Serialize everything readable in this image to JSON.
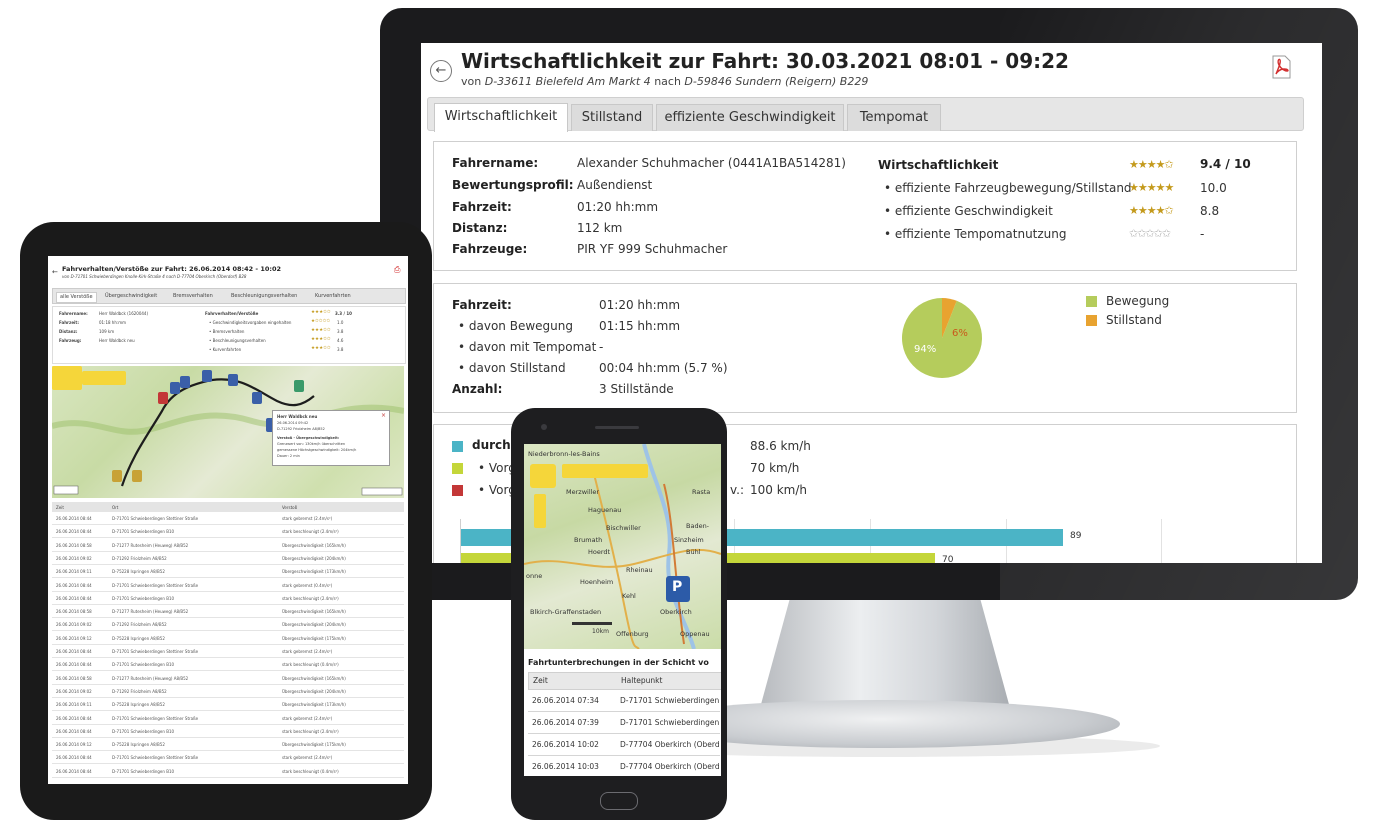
{
  "monitor": {
    "title": "Wirtschaftlichkeit zur Fahrt: 30.03.2021 08:01 - 09:22",
    "subtitle_prefix": "von",
    "subtitle_from": "D-33611 Bielefeld Am Markt 4",
    "subtitle_mid": "nach",
    "subtitle_to": "D-59846 Sundern (Reigern) B229",
    "tabs": [
      "Wirtschaftlichkeit",
      "Stillstand",
      "effiziente Geschwindigkeit",
      "Tempomat"
    ],
    "info": {
      "driver_label": "Fahrername:",
      "driver_value": "Alexander Schuhmacher (0441A1BA514281)",
      "profile_label": "Bewertungsprofil:",
      "profile_value": "Außendienst",
      "time_label": "Fahrzeit:",
      "time_value": "01:20 hh:mm",
      "distance_label": "Distanz:",
      "distance_value": "112 km",
      "vehicles_label": "Fahrzeuge:",
      "vehicles_value": "PIR YF 999 Schuhmacher"
    },
    "rating": {
      "title": "Wirtschaftlichkeit",
      "title_stars": "★★★★✩",
      "title_score": "9.4 / 10",
      "items": [
        {
          "label": "• effiziente Fahrzeugbewegung/Stillstand",
          "stars": "★★★★★",
          "score": "10.0"
        },
        {
          "label": "• effiziente Geschwindigkeit",
          "stars": "★★★★✩",
          "score": "8.8"
        },
        {
          "label": "• effiziente Tempomatnutzung",
          "stars": "✩✩✩✩✩",
          "score": "-"
        }
      ]
    },
    "standstill": {
      "time_label": "Fahrzeit:",
      "time_value": "01:20 hh:mm",
      "movement_label": "• davon Bewegung",
      "movement_value": "01:15 hh:mm",
      "tempomat_label": "• davon mit Tempomat",
      "tempomat_value": "-",
      "still_label": "• davon Stillstand",
      "still_value": "00:04 hh:mm (5.7 %)",
      "count_label": "Anzahl:",
      "count_value": "3 Stillstände",
      "pie_big_label": "94%",
      "pie_small_label": "6%",
      "legend": [
        {
          "label": "Bewegung",
          "color": "#b5cc5c"
        },
        {
          "label": "Stillstand",
          "color": "#e8a330"
        }
      ]
    },
    "speed": {
      "avg_label": "durchs",
      "avg_value": "88.6 km/h",
      "rows": [
        {
          "label": "• Vorga",
          "value": "70 km/h",
          "color": "#b5cc5c"
        },
        {
          "label": "• Vorga",
          "prefix": "v.:",
          "value": "100 km/h",
          "color": "#c33737"
        }
      ],
      "bar_value_label": "89",
      "bar2_value_label": "70",
      "bar_color": "#4bb4c6",
      "bar2_color": "#c4d63a"
    }
  },
  "chart_data": {
    "type": "pie",
    "categories": [
      "Bewegung",
      "Stillstand"
    ],
    "values": [
      94,
      6
    ],
    "colors": [
      "#b5cc5c",
      "#e8a330"
    ],
    "legend": "right"
  },
  "tablet": {
    "title": "Fahrverhalten/Verstöße zur Fahrt: 26.06.2014 08:42 - 10:02",
    "subtitle": "von D-71701 Schwieberdingen Knolle-Kirk-Straße 4 nach D-77704 Oberkirch (Oberdorf) B28",
    "tabs": [
      "alle Verstöße",
      "Übergeschwindigkeit",
      "Bremsverhalten",
      "Beschleunigungsverhalten",
      "Kurvenfahrten"
    ],
    "info_left": [
      {
        "label": "Fahrername:",
        "value": "Herr Waldbck (1620044)"
      },
      {
        "label": "Fahrzeit:",
        "value": "01:18 hh:mm"
      },
      {
        "label": "Distanz:",
        "value": "109 km"
      },
      {
        "label": "Fahrzeug:",
        "value": "Herr Waldbck neu"
      }
    ],
    "info_right_title": "Fahrverhalten/Verstöße",
    "info_right_score": "3.3 / 10",
    "info_right": [
      {
        "label": "• Geschwindigkeitsvorgaben eingehalten",
        "score": "1.0"
      },
      {
        "label": "• Bremsverhalten",
        "score": "3.8"
      },
      {
        "label": "• Beschleunigungsverhalten",
        "score": "4.6"
      },
      {
        "label": "• Kurvenfahrten",
        "score": "3.8"
      }
    ],
    "popup_title": "Herr Waldbck neu",
    "popup_lines": [
      "26.06.2014 09:42",
      "D-71292 Friolzheim A8/B52",
      "Verstoß - Übergeschwindigkeit:",
      "Grenzwert von: 130km/h überschritten",
      "gemessene Höchstgeschwindigkeit: 204km/h",
      "Dauer: 2 min"
    ],
    "table_headers": [
      "Zeit",
      "Ort",
      "Verstoß"
    ],
    "table_rows": [
      [
        "26.06.2014 08:44",
        "D-71701 Schwieberdingen Stettiner Straße",
        "stark gebremst (2.4m/s²)"
      ],
      [
        "26.06.2014 08:44",
        "D-71701 Schwieberdingen B10",
        "stark beschleunigt (2.4m/s²)"
      ],
      [
        "26.06.2014 08:58",
        "D-71277 Rutesheim (Heuweg) A8/B52",
        "Übergeschwindigkeit (165km/h)"
      ],
      [
        "26.06.2014 09:02",
        "D-71292 Friolzheim A8/B52",
        "Übergeschwindigkeit (204km/h)"
      ],
      [
        "26.06.2014 09:11",
        "D-75228 Ispringen A8/B52",
        "Übergeschwindigkeit (173km/h)"
      ],
      [
        "26.06.2014 08:44",
        "D-71701 Schwieberdingen Stettiner Straße",
        "stark gebremst (0.4m/s²)"
      ],
      [
        "26.06.2014 08:44",
        "D-71701 Schwieberdingen B10",
        "stark beschleunigt (2.4m/s²)"
      ],
      [
        "26.06.2014 08:58",
        "D-71277 Rutesheim (Heuweg) A8/B52",
        "Übergeschwindigkeit (165km/h)"
      ],
      [
        "26.06.2014 09:02",
        "D-71292 Friolzheim A8/B52",
        "Übergeschwindigkeit (204km/h)"
      ],
      [
        "26.06.2014 09:12",
        "D-75228 Ispringen A8/B52",
        "Übergeschwindigkeit (175km/h)"
      ],
      [
        "26.06.2014 08:44",
        "D-71701 Schwieberdingen Stettiner Straße",
        "stark gebremst (2.4m/s²)"
      ],
      [
        "26.06.2014 08:44",
        "D-71701 Schwieberdingen B10",
        "stark beschleunigt (0.4m/s²)"
      ],
      [
        "26.06.2014 08:58",
        "D-71277 Rutesheim (Heuweg) A8/B52",
        "Übergeschwindigkeit (165km/h)"
      ],
      [
        "26.06.2014 09:02",
        "D-71292 Friolzheim A8/B52",
        "Übergeschwindigkeit (204km/h)"
      ],
      [
        "26.06.2014 09:11",
        "D-75228 Ispringen A8/B52",
        "Übergeschwindigkeit (173km/h)"
      ],
      [
        "26.06.2014 08:44",
        "D-71701 Schwieberdingen Stettiner Straße",
        "stark gebremst (2.4m/s²)"
      ],
      [
        "26.06.2014 08:44",
        "D-71701 Schwieberdingen B10",
        "stark beschleunigt (2.4m/s²)"
      ],
      [
        "26.06.2014 09:12",
        "D-75228 Ispringen A8/B52",
        "Übergeschwindigkeit (175km/h)"
      ],
      [
        "26.06.2014 08:44",
        "D-71701 Schwieberdingen Stettiner Straße",
        "stark gebremst (2.4m/s²)"
      ],
      [
        "26.06.2014 08:44",
        "D-71701 Schwieberdingen B10",
        "stark beschleunigt (0.4m/s²)"
      ]
    ]
  },
  "phone": {
    "map_places": [
      "Niederbronn-les-Bains",
      "Merzwiller",
      "Haguenau",
      "Rasta",
      "Bischwiller",
      "Baden-",
      "Brumath",
      "Sinzheim",
      "Bühl",
      "Hoerdt",
      "Rheinau",
      "onne",
      "Hoenheim",
      "Kehl",
      "Blkirch-Graffenstaden",
      "Oberkirch",
      "Offenburg",
      "Oppenau"
    ],
    "scale_label": "10km",
    "parking_label": "P",
    "table_title": "Fahrtunterbrechungen in der Schicht vo",
    "headers": [
      "Zeit",
      "Haltepunkt"
    ],
    "rows": [
      [
        "26.06.2014 07:34",
        "D-71701 Schwieberdingen"
      ],
      [
        "26.06.2014 07:39",
        "D-71701 Schwieberdingen"
      ],
      [
        "26.06.2014 10:02",
        "D-77704 Oberkirch (Oberd"
      ],
      [
        "26.06.2014 10:03",
        "D-77704 Oberkirch (Oberd"
      ]
    ]
  }
}
